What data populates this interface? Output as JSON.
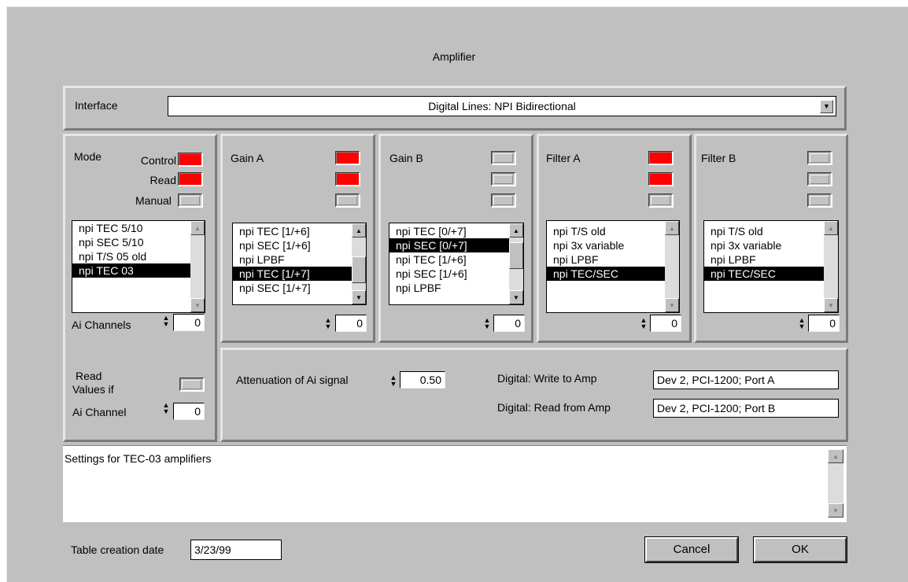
{
  "window": {
    "title": "Amplifier"
  },
  "interface": {
    "label": "Interface",
    "value": "Digital Lines: NPI Bidirectional"
  },
  "mode": {
    "label": "Mode",
    "leds": [
      {
        "label": "Control",
        "on": true
      },
      {
        "label": "Read",
        "on": true
      },
      {
        "label": "Manual",
        "on": false
      }
    ],
    "list": [
      "npi TEC 5/10",
      "npi SEC 5/10",
      "npi T/S 05 old",
      "npi TEC 03"
    ],
    "selected_index": 3,
    "ai_channels_label": "Ai Channels",
    "ai_channels_value": "0"
  },
  "gain_a": {
    "label": "Gain A",
    "leds": [
      true,
      true,
      false
    ],
    "list": [
      "npi TEC [1/+6]",
      "npi SEC [1/+6]",
      "npi LPBF",
      "npi TEC [1/+7]",
      "npi SEC [1/+7]"
    ],
    "selected_index": 3,
    "value": "0"
  },
  "gain_b": {
    "label": "Gain B",
    "leds": [
      false,
      false,
      false
    ],
    "list": [
      "npi TEC [0/+7]",
      "npi SEC [0/+7]",
      "npi TEC [1/+6]",
      "npi SEC [1/+6]",
      "npi LPBF"
    ],
    "selected_index": 1,
    "value": "0"
  },
  "filter_a": {
    "label": "Filter A",
    "leds": [
      true,
      true,
      false
    ],
    "list": [
      "npi T/S old",
      "npi 3x variable",
      "npi LPBF",
      "npi TEC/SEC"
    ],
    "selected_index": 3,
    "value": "0"
  },
  "filter_b": {
    "label": "Filter B",
    "leds": [
      false,
      false,
      false
    ],
    "list": [
      "npi T/S old",
      "npi 3x variable",
      "npi LPBF",
      "npi TEC/SEC"
    ],
    "selected_index": 3,
    "value": "0"
  },
  "read_values": {
    "label_line1": "Read",
    "label_line2": "Values if",
    "label_line3": "Ai Channel",
    "value": "0"
  },
  "settings": {
    "attenuation_label": "Attenuation of Ai signal",
    "attenuation_value": "0.50",
    "write_label": "Digital: Write to Amp",
    "write_value": "Dev 2, PCI-1200; Port A",
    "read_label": "Digital: Read from Amp",
    "read_value": "Dev 2, PCI-1200; Port B"
  },
  "notes": {
    "text": "Settings for TEC-03 amplifiers"
  },
  "footer": {
    "date_label": "Table creation date",
    "date_value": "3/23/99",
    "cancel_label": "Cancel",
    "ok_label": "OK"
  },
  "colors": {
    "led_on": "#ff0000",
    "background": "#c0c0c0"
  }
}
